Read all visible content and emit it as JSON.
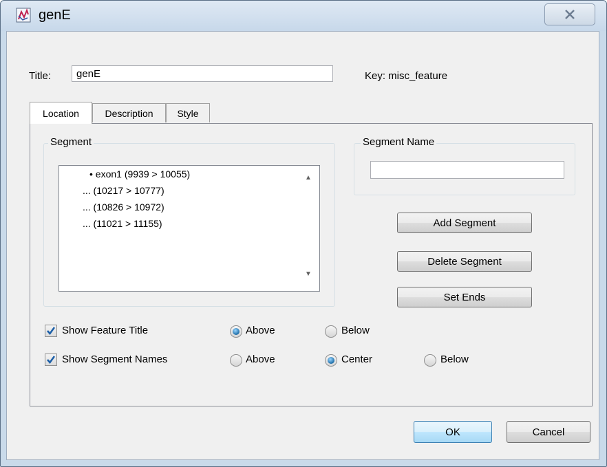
{
  "window": {
    "title": "genE"
  },
  "form": {
    "title_label": "Title:",
    "title_value": "genE",
    "key_text": "Key: misc_feature"
  },
  "tabs": [
    {
      "label": "Location",
      "active": true
    },
    {
      "label": "Description",
      "active": false
    },
    {
      "label": "Style",
      "active": false
    }
  ],
  "segment": {
    "group_label": "Segment",
    "items": [
      "• exon1 (9939 > 10055)",
      "... (10217 > 10777)",
      "... (10826 > 10972)",
      "... (11021 > 11155)"
    ]
  },
  "segment_name": {
    "group_label": "Segment Name",
    "value": ""
  },
  "buttons": {
    "add_segment": "Add Segment",
    "delete_segment": "Delete Segment",
    "set_ends": "Set Ends",
    "ok": "OK",
    "cancel": "Cancel"
  },
  "options": {
    "show_feature_title": {
      "label": "Show Feature Title",
      "checked": true,
      "above": "Above",
      "below": "Below",
      "selected": "Above"
    },
    "show_segment_names": {
      "label": "Show Segment Names",
      "checked": true,
      "above": "Above",
      "center": "Center",
      "below": "Below",
      "selected": "Center"
    }
  },
  "colors": {
    "check": "#1c5fa8",
    "frame": "#c9daea",
    "default_button": "#3c7fb1"
  }
}
